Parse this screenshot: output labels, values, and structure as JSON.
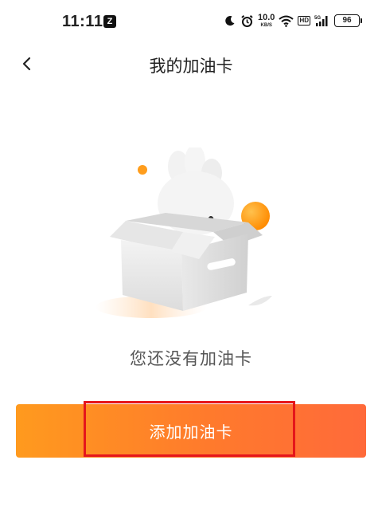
{
  "status_bar": {
    "time": "11:11",
    "notification_letter": "Z",
    "network_speed_value": "10.0",
    "network_speed_unit": "KB/S",
    "hd_label": "HD",
    "signal_label": "5G",
    "battery": "96"
  },
  "header": {
    "title": "我的加油卡"
  },
  "main": {
    "empty_message": "您还没有加油卡",
    "add_button_label": "添加加油卡"
  },
  "colors": {
    "accent_start": "#ff9a1e",
    "accent_end": "#ff6a3a",
    "highlight": "#e5161b"
  },
  "icons": {
    "back": "chevron-left-icon",
    "moon": "moon-icon",
    "alarm": "alarm-icon",
    "wifi": "wifi-icon",
    "signal": "signal-icon",
    "battery": "battery-icon"
  }
}
